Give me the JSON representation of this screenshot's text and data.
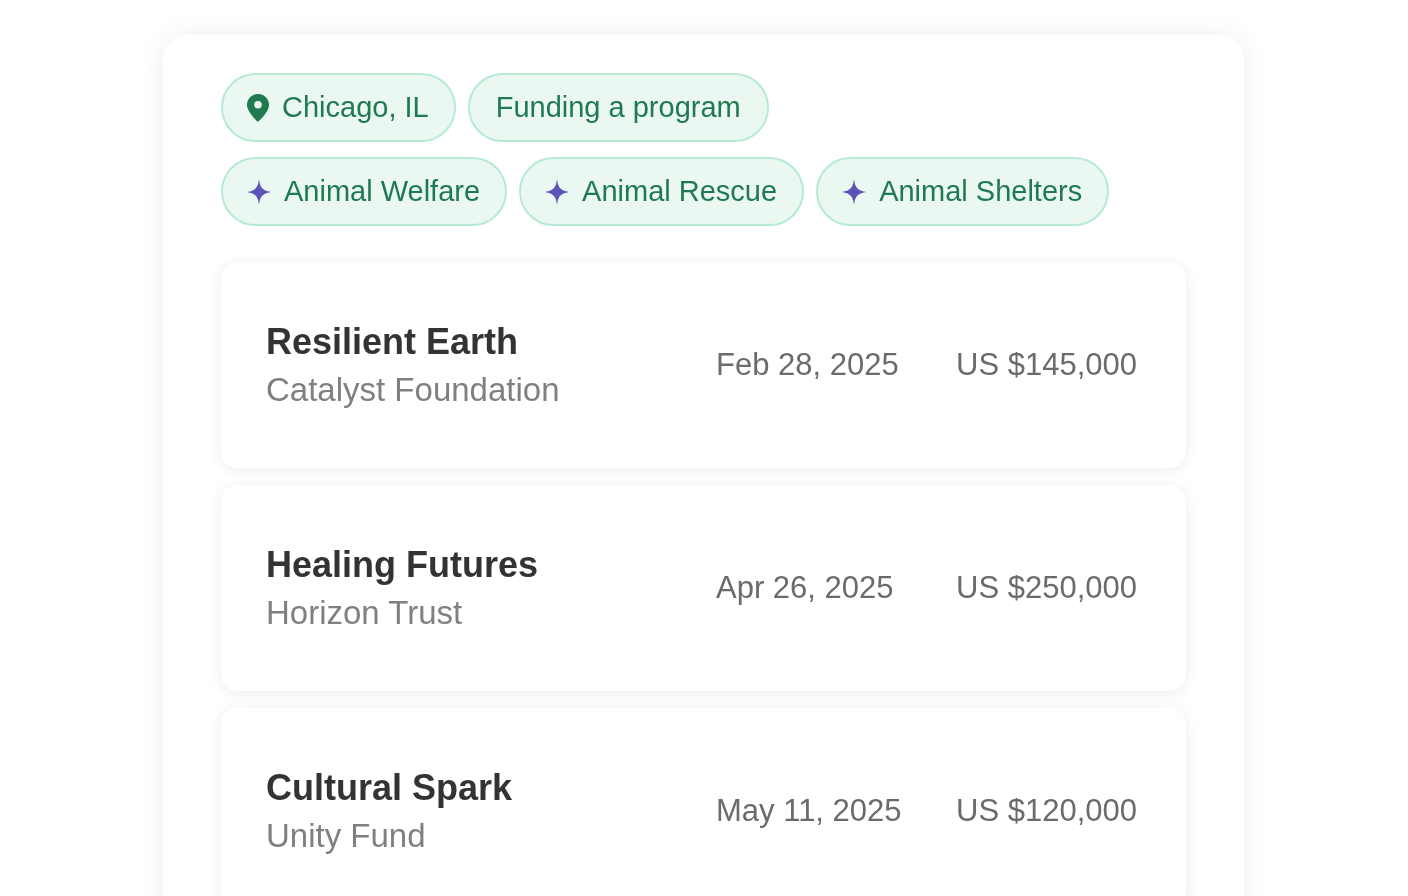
{
  "filters": [
    {
      "kind": "location",
      "label": "Chicago, IL"
    },
    {
      "kind": "plain",
      "label": "Funding a program"
    }
  ],
  "topics": [
    {
      "label": "Animal Welfare"
    },
    {
      "label": "Animal Rescue"
    },
    {
      "label": "Animal Shelters"
    }
  ],
  "grants": [
    {
      "title": "Resilient Earth",
      "funder": "Catalyst Foundation",
      "deadline": "Feb 28, 2025",
      "amount": "US $145,000"
    },
    {
      "title": "Healing Futures",
      "funder": "Horizon Trust",
      "deadline": "Apr 26, 2025",
      "amount": "US $250,000"
    },
    {
      "title": "Cultural Spark",
      "funder": "Unity Fund",
      "deadline": "May 11, 2025",
      "amount": "US $120,000"
    }
  ]
}
